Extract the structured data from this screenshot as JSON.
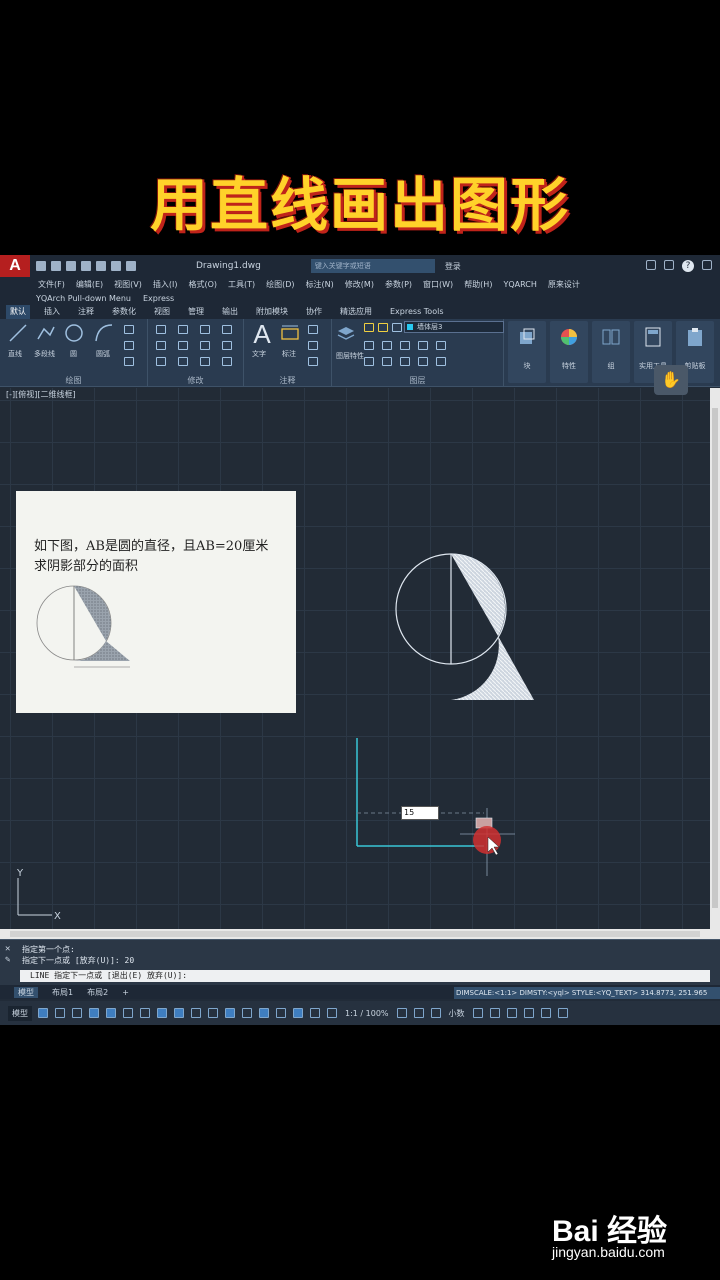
{
  "caption": "用直线画出图形",
  "app": {
    "logo": "A",
    "title": "Drawing1.dwg",
    "search_placeholder": "键入关键字或短语",
    "login": "登录",
    "menu": [
      "文件(F)",
      "编辑(E)",
      "视图(V)",
      "插入(I)",
      "格式(O)",
      "工具(T)",
      "绘图(D)",
      "标注(N)",
      "修改(M)",
      "参数(P)",
      "窗口(W)",
      "帮助(H)",
      "YQARCH",
      "原来设计"
    ],
    "menu2": [
      "YQArch Pull-down Menu",
      "Express"
    ],
    "tabs": [
      "默认",
      "插入",
      "注释",
      "参数化",
      "视图",
      "管理",
      "输出",
      "附加模块",
      "协作",
      "精选应用",
      "Express Tools"
    ],
    "ribbon": {
      "draw_tools": [
        "直线",
        "多段线",
        "圆",
        "圆弧"
      ],
      "draw_panel": "绘图",
      "modify_panel": "修改",
      "annot_tools": [
        "文字",
        "标注"
      ],
      "annot_panel": "注释",
      "layer_tool": "图层特性",
      "layer_current": "墙体层3",
      "layer_panel": "图层",
      "block": "块",
      "properties": "特性",
      "group": "组",
      "utilities": "实用工具",
      "clipboard": "剪贴板"
    },
    "viewport_label": "[-][俯视][二维线框]",
    "paper": {
      "question_line1": "如下图，AB是圆的直径，且AB=20厘米",
      "question_line2": "求阴影部分的面积"
    },
    "dynamic_input": "15",
    "command": {
      "line1": "指定第一个点:",
      "line2": "指定下一点或 [放弃(U)]: 20",
      "prompt": "LINE 指定下一点或 [退出(E) 放弃(U)]:"
    },
    "layout_tabs": [
      "模型",
      "布局1",
      "布局2",
      "+"
    ],
    "dim_status": "DIMSCALE:<1:1> DIMSTY:<yql> STYLE:<YQ_TEXT>  314.8773, 251.965",
    "status": {
      "model": "模型",
      "scale": "1:1 / 100%",
      "small": "小数"
    }
  },
  "watermark": {
    "logo": "Bai 经验",
    "url": "jingyan.baidu.com"
  }
}
